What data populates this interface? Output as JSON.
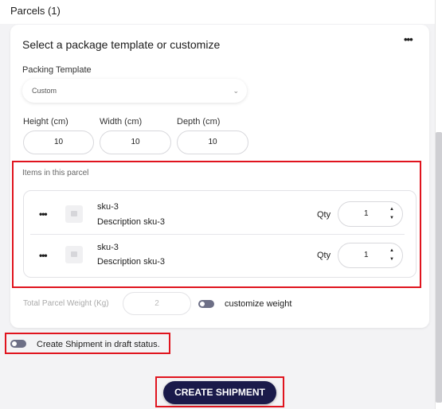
{
  "parcels": {
    "title": "Parcels (1)"
  },
  "card": {
    "title": "Select a package template or customize",
    "menu_icon": "more-horizontal-icon",
    "packing_template": {
      "label": "Packing Template",
      "value": "Custom",
      "chevron": "⌄"
    },
    "dimensions": [
      {
        "label": "Height (cm)",
        "value": "10"
      },
      {
        "label": "Width (cm)",
        "value": "10"
      },
      {
        "label": "Depth (cm)",
        "value": "10"
      }
    ],
    "items_label": "Items in this parcel",
    "items": [
      {
        "sku": "sku-3",
        "description": "Description sku-3",
        "qty_label": "Qty",
        "qty": "1"
      },
      {
        "sku": "sku-3",
        "description": "Description sku-3",
        "qty_label": "Qty",
        "qty": "1"
      }
    ],
    "weight": {
      "label": "Total Parcel Weight (Kg)",
      "value": "2",
      "toggle_label": "customize weight"
    }
  },
  "draft": {
    "label": "Create Shipment in draft status."
  },
  "create_button": {
    "label": "CREATE SHIPMENT"
  },
  "colors": {
    "accent": "#1a1a4a",
    "highlight": "#e0141e",
    "toggle": "#6d6f86"
  }
}
